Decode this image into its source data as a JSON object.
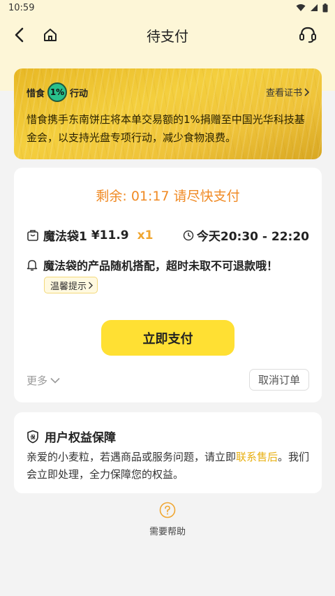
{
  "status_bar": {
    "time": "10:59"
  },
  "nav": {
    "title": "待支付"
  },
  "banner": {
    "label_left": "惜食",
    "badge": "1%",
    "label_right": "行动",
    "link": "查看证书",
    "description": "惜食携手东南饼庄将本单交易额的1%捐赠至中国光华科技基金会，以支持光盘专项行动，减少食物浪费。"
  },
  "order": {
    "countdown": "剩余: 01:17  请尽快支付",
    "item_name": "魔法袋1",
    "price": "¥11.9",
    "quantity": "x1",
    "pickup_time": "今天20:30 - 22:20",
    "notice": "魔法袋的产品随机搭配，超时未取不可退款哦！",
    "tip_label": "温馨提示",
    "pay_button": "立即支付",
    "more_label": "更多",
    "cancel_button": "取消订单"
  },
  "rights": {
    "title": "用户权益保障",
    "desc_before": "亲爱的小麦粒，若遇商品或服务问题，请立即",
    "link": "联系售后",
    "desc_after": "。我们会立即处理，全力保障您的权益。"
  },
  "help": {
    "label": "需要帮助"
  },
  "colors": {
    "accent_yellow": "#ffe033",
    "countdown_orange": "#f08a24",
    "link_gold": "#e8b012",
    "header_bg": "#fdf6d7"
  }
}
